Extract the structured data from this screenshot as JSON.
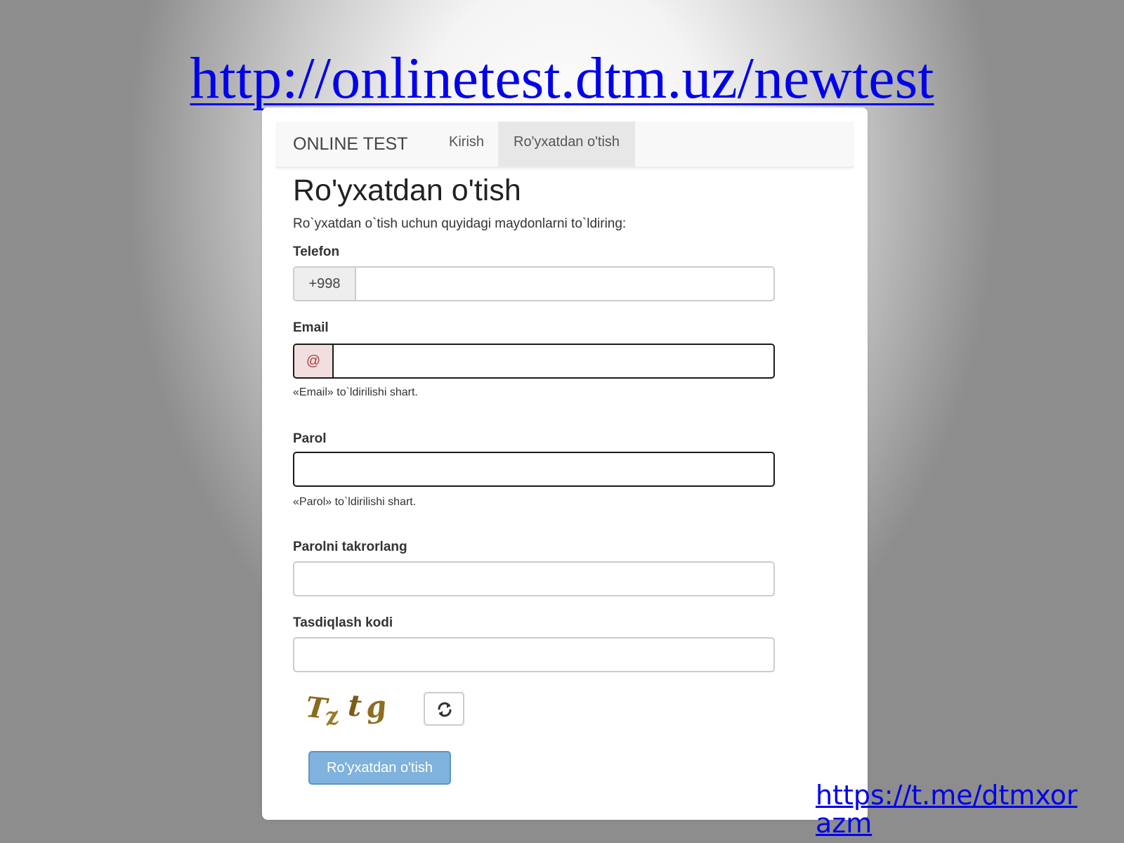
{
  "slide": {
    "url": "http://onlinetest.dtm.uz/newtest",
    "telegram_link": "https://t.me/dtmxorazm"
  },
  "navbar": {
    "brand": "ONLINE TEST",
    "links": [
      {
        "label": "Kirish",
        "active": false
      },
      {
        "label": "Ro'yxatdan o'tish",
        "active": true
      }
    ]
  },
  "form": {
    "title": "Ro'yxatdan o'tish",
    "intro": "Ro`yxatdan o`tish uchun quyidagi maydonlarni to`ldiring:",
    "fields": {
      "phone": {
        "label": "Telefon",
        "prefix": "+998",
        "value": ""
      },
      "email": {
        "label": "Email",
        "prefix": "@",
        "value": "",
        "error": "«Email» to`ldirilishi shart."
      },
      "password": {
        "label": "Parol",
        "value": "",
        "error": "«Parol» to`ldirilishi shart."
      },
      "password_repeat": {
        "label": "Parolni takrorlang",
        "value": ""
      },
      "verification_code": {
        "label": "Tasdiqlash kodi",
        "value": ""
      }
    },
    "captcha": {
      "text": "Tztg",
      "refresh_icon": "refresh-icon"
    },
    "submit_label": "Ro'yxatdan o'tish"
  },
  "colors": {
    "link": "#0000ee",
    "error_border": "#1b1b1b",
    "error_addon_bg": "#f2dede",
    "submit_bg": "#7fb2dc"
  }
}
